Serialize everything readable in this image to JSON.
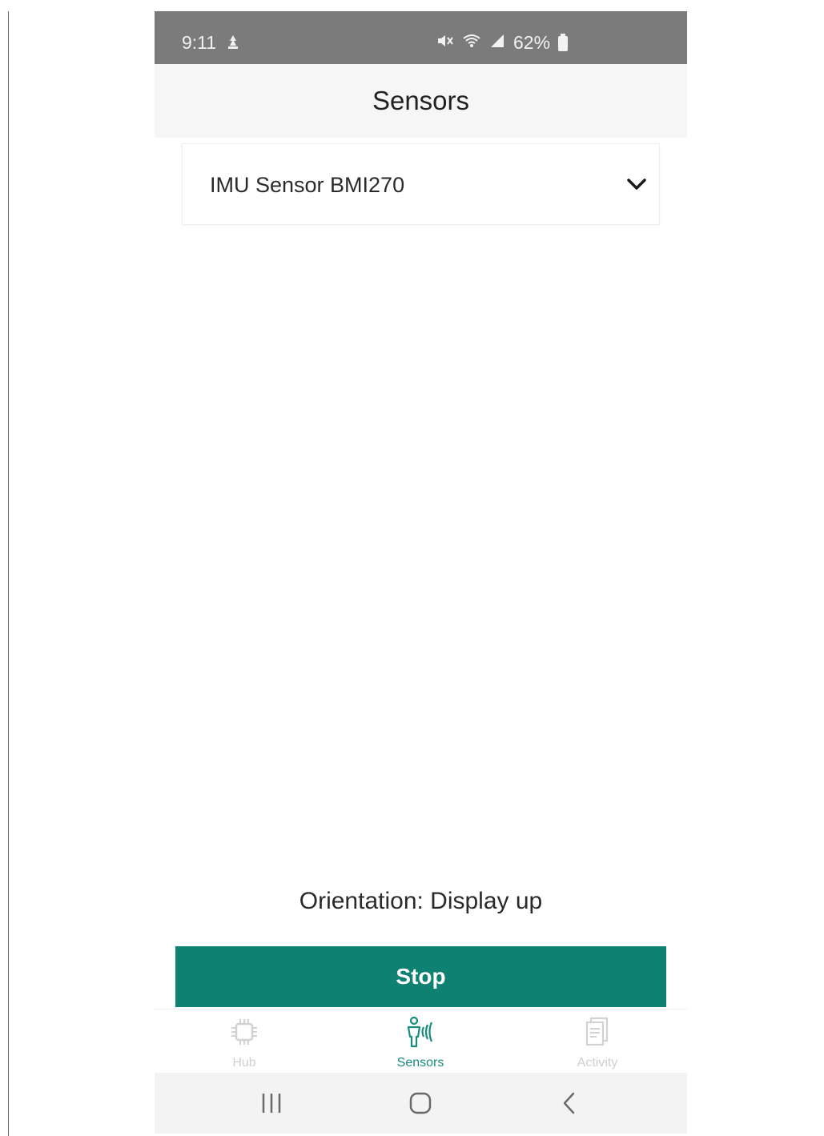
{
  "status_bar": {
    "time": "9:11",
    "battery_percent": "62%"
  },
  "app_bar": {
    "title": "Sensors"
  },
  "sensor_select": {
    "selected": "IMU Sensor BMI270"
  },
  "orientation_text": "Orientation: Display up",
  "stop_button": {
    "label": "Stop",
    "color": "#0f8172"
  },
  "bottom_nav": {
    "items": [
      {
        "label": "Hub",
        "icon": "chip-icon",
        "active": false
      },
      {
        "label": "Sensors",
        "icon": "person-sensor-icon",
        "active": true
      },
      {
        "label": "Activity",
        "icon": "document-icon",
        "active": false
      }
    ],
    "active_color": "#188c7c"
  },
  "system_nav": {
    "buttons": [
      "recent-apps",
      "home",
      "back"
    ]
  }
}
